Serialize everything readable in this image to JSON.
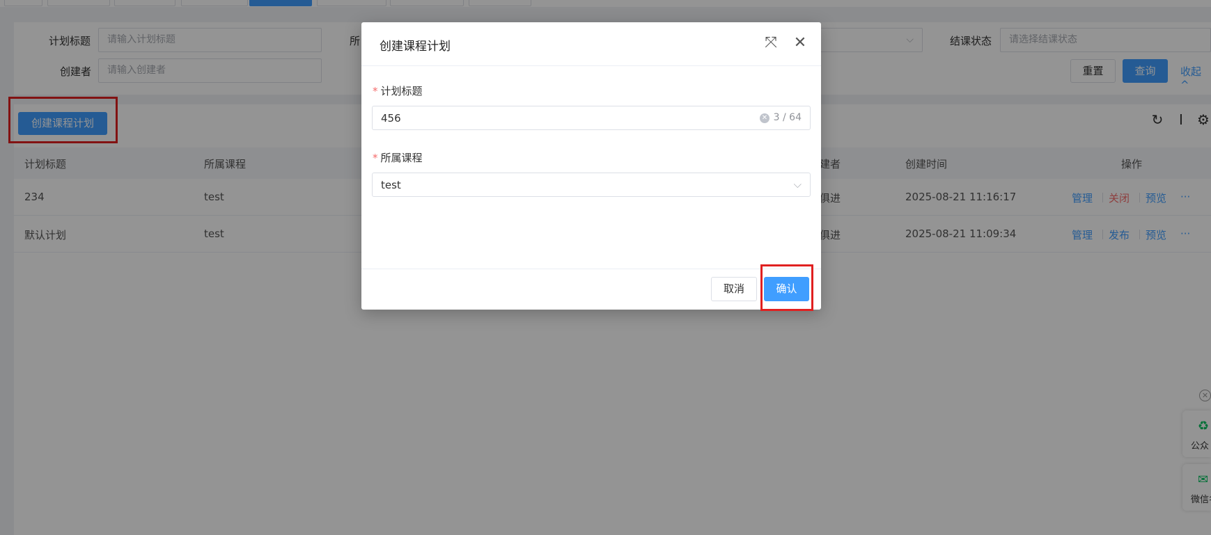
{
  "search": {
    "plan_title_label": "计划标题",
    "plan_title_placeholder": "请输入计划标题",
    "creator_label": "创建者",
    "creator_placeholder": "请输入创建者",
    "course_label_partial": "所",
    "end_status_label": "结课状态",
    "end_status_placeholder": "请选择结课状态",
    "reset_label": "重置",
    "query_label": "查询",
    "collapse_label": "收起 ^"
  },
  "toolbar": {
    "create_label": "创建课程计划"
  },
  "table": {
    "columns": [
      "计划标题",
      "所属课程",
      "建者",
      "创建时间",
      "操作"
    ],
    "rows": [
      {
        "title": "234",
        "course": "test",
        "creator": "俱进",
        "created": "2025-08-21 11:16:17",
        "actions": [
          "管理",
          "关闭",
          "预览",
          "···"
        ]
      },
      {
        "title": "默认计划",
        "course": "test",
        "creator": "俱进",
        "created": "2025-08-21 11:09:34",
        "actions": [
          "管理",
          "发布",
          "预览",
          "···"
        ]
      }
    ]
  },
  "float_panel": {
    "card1_label": "公众",
    "card2_label": "微信名"
  },
  "modal": {
    "title": "创建课程计划",
    "field1_label": "计划标题",
    "field1_value": "456",
    "field1_count": "3 / 64",
    "field2_label": "所属课程",
    "field2_value": "test",
    "cancel_label": "取消",
    "confirm_label": "确认"
  },
  "colors": {
    "primary": "#409eff",
    "danger": "#f56c6c",
    "highlight": "#e02020"
  }
}
